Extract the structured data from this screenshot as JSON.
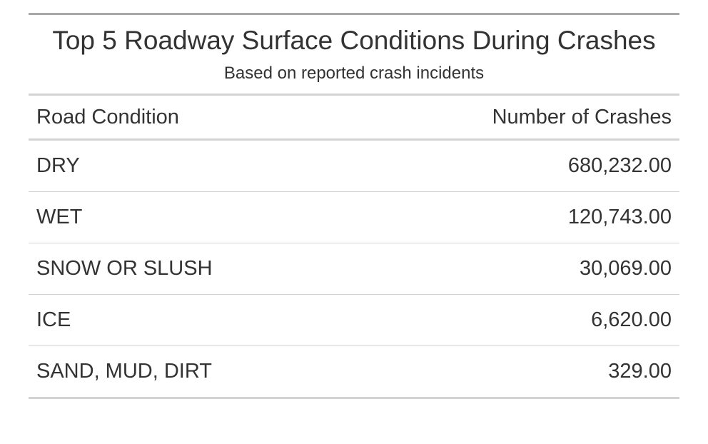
{
  "chart_data": {
    "type": "table",
    "title": "Top 5 Roadway Surface Conditions During Crashes",
    "subtitle": "Based on reported crash incidents",
    "columns": [
      "Road Condition",
      "Number of Crashes"
    ],
    "rows": [
      {
        "condition": "DRY",
        "crashes": 680232,
        "crashes_label": "680,232.00"
      },
      {
        "condition": "WET",
        "crashes": 120743,
        "crashes_label": "120,743.00"
      },
      {
        "condition": "SNOW OR SLUSH",
        "crashes": 30069,
        "crashes_label": "30,069.00"
      },
      {
        "condition": "ICE",
        "crashes": 6620,
        "crashes_label": "6,620.00"
      },
      {
        "condition": "SAND, MUD, DIRT",
        "crashes": 329,
        "crashes_label": "329.00"
      }
    ]
  },
  "colors": {
    "text": "#333333",
    "top_rule": "#a8a8a8",
    "rule": "#d3d3d3",
    "background": "#ffffff"
  }
}
